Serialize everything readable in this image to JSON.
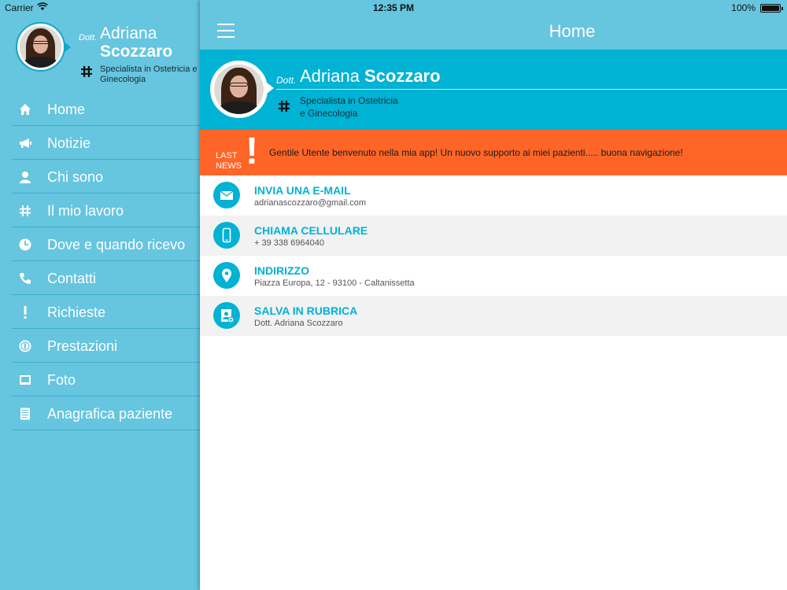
{
  "status_bar": {
    "carrier": "Carrier",
    "time": "12:35 PM",
    "battery": "100%"
  },
  "sidebar": {
    "dott": "Dott.",
    "first_name": "Adriana",
    "last_name": "Scozzaro",
    "specialty_line1": "Specialista in Ostetricia e",
    "specialty_line2": "Ginecologia",
    "menu": [
      {
        "label": "Home",
        "icon": "home-icon"
      },
      {
        "label": "Notizie",
        "icon": "megaphone-icon"
      },
      {
        "label": "Chi sono",
        "icon": "person-icon"
      },
      {
        "label": "Il mio lavoro",
        "icon": "medical-cross-icon"
      },
      {
        "label": "Dove e quando ricevo",
        "icon": "clock-icon"
      },
      {
        "label": "Contatti",
        "icon": "phone-icon"
      },
      {
        "label": "Richieste",
        "icon": "exclamation-icon"
      },
      {
        "label": "Prestazioni",
        "icon": "coin-icon"
      },
      {
        "label": "Foto",
        "icon": "photo-icon"
      },
      {
        "label": "Anagrafica paziente",
        "icon": "document-icon"
      }
    ]
  },
  "main": {
    "title": "Home",
    "header": {
      "dott": "Dott.",
      "first_name": "Adriana",
      "last_name": "Scozzaro",
      "specialty_line1": "Specialista in Ostetricia",
      "specialty_line2": "e Ginecologia"
    },
    "news": {
      "label_line1": "LAST",
      "label_line2": "NEWS",
      "bang": "!",
      "text": "Gentile Utente benvenuto nella mia app! Un nuovo supporto ai miei pazienti..... buona navigazione!"
    },
    "contacts": [
      {
        "title": "INVIA UNA E-MAIL",
        "subtitle": "adrianascozzaro@gmail.com",
        "icon": "mail-icon"
      },
      {
        "title": "CHIAMA CELLULARE",
        "subtitle": "+ 39 338 6964040",
        "icon": "mobile-phone-icon"
      },
      {
        "title": "INDIRIZZO",
        "subtitle": "Piazza Europa, 12 - 93100 - Caltanissetta",
        "icon": "location-pin-icon"
      },
      {
        "title": "SALVA IN RUBRICA",
        "subtitle": "Dott. Adriana Scozzaro",
        "icon": "add-contact-icon"
      }
    ]
  },
  "colors": {
    "sidebar_bg": "#66c5df",
    "header_bg": "#00b2d4",
    "news_bg": "#ff6527",
    "accent": "#00b2d4"
  }
}
